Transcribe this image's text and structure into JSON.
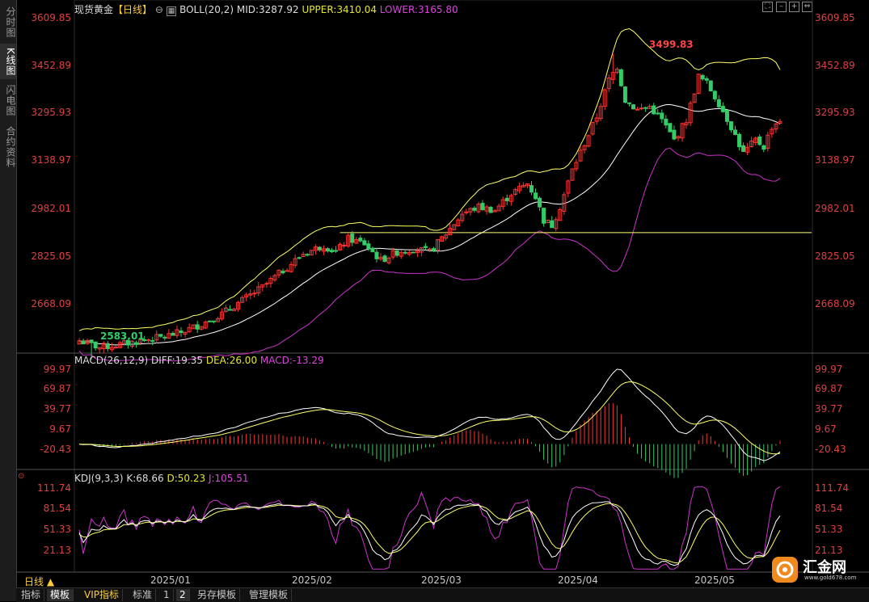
{
  "left_tabs": [
    "分时图",
    "K线图",
    "闪电图",
    "合约资料"
  ],
  "price_legend": {
    "name": "现货黄金",
    "period": "【日线】",
    "indicator": "BOLL(20,2)",
    "mid": "MID:3287.92",
    "upper": "UPPER:3410.04",
    "lower": "LOWER:3165.80"
  },
  "macd_legend": {
    "name": "MACD(26,12,9)",
    "diff": "DIFF:19.35",
    "dea": "DEA:26.00",
    "macd": "MACD:-13.29"
  },
  "kdj_legend": {
    "name": "KDJ(9,3,3)",
    "k": "K:68.66",
    "d": "D:50.23",
    "j": "J:105.51"
  },
  "price_axis": [
    "3609.85",
    "3452.89",
    "3295.93",
    "3138.97",
    "2982.01",
    "2825.05",
    "2668.09"
  ],
  "macd_axis": [
    "99.97",
    "69.87",
    "39.77",
    "9.67",
    "-20.43"
  ],
  "kdj_axis": [
    "111.74",
    "81.54",
    "51.33",
    "21.13"
  ],
  "annotations": {
    "high": "3499.83",
    "low": "2583.01"
  },
  "dates": [
    "2025/01",
    "2025/02",
    "2025/03",
    "2025/04",
    "2025/05"
  ],
  "period_label": "日线 ▲",
  "bottom_tabs": [
    "指标",
    "模板",
    "VIP指标",
    "标准",
    "1",
    "2",
    "另存模板",
    "管理模板"
  ],
  "logo": {
    "name": "汇金网",
    "url": "www.gold678.com"
  },
  "colors": {
    "up": "#ff3333",
    "down": "#33cc66",
    "mid": "#ffffff",
    "upper": "#ffff66",
    "lower": "#cc33cc",
    "support": "#ffff66"
  },
  "chart_data": {
    "type": "candlestick",
    "price_range": [
      2610,
      3620
    ],
    "macd_range": [
      -32,
      112
    ],
    "kdj_range": [
      0,
      125
    ],
    "support_level": 2963,
    "high": 3499.83,
    "low": 2583.01
  }
}
